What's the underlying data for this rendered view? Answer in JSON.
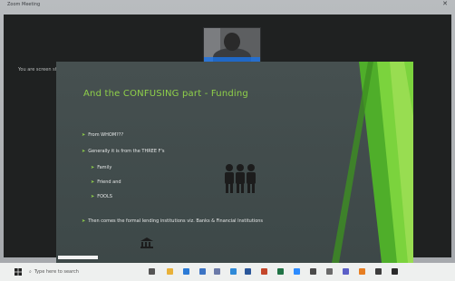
{
  "window": {
    "app_title": "Zoom Meeting",
    "close_glyph": "✕"
  },
  "share_bar": {
    "label": "You are screen sharing"
  },
  "slide": {
    "title": "And the CONFUSING part - Funding",
    "bullets": [
      {
        "level": 0,
        "text": "From WHOM???"
      },
      {
        "level": 0,
        "text": "Generally it is from the THREE F's"
      },
      {
        "level": 1,
        "text": "Family"
      },
      {
        "level": 1,
        "text": "Friend and"
      },
      {
        "level": 1,
        "text": "FOOLS"
      },
      {
        "level": 0,
        "text": "Then comes the formal lending institutions viz. Banks & Financial Institutions"
      }
    ],
    "accent_color": "#8fd04a",
    "icons": [
      "people-group-icon",
      "bank-icon"
    ]
  },
  "meeting_controls": {
    "icons": [
      "participants-icon",
      "chat-icon",
      "share-icon"
    ],
    "end_color": "#d93025"
  },
  "taskbar": {
    "search_placeholder": "Type here to search",
    "icons": [
      "task-view-icon",
      "file-explorer-icon",
      "edge-icon",
      "store-icon",
      "mail-icon",
      "chrome-icon",
      "word-icon",
      "powerpoint-icon",
      "excel-icon",
      "zoom-icon",
      "photos-icon",
      "settings-icon",
      "teams-icon",
      "vlc-icon",
      "calculator-icon",
      "camera-icon"
    ]
  }
}
